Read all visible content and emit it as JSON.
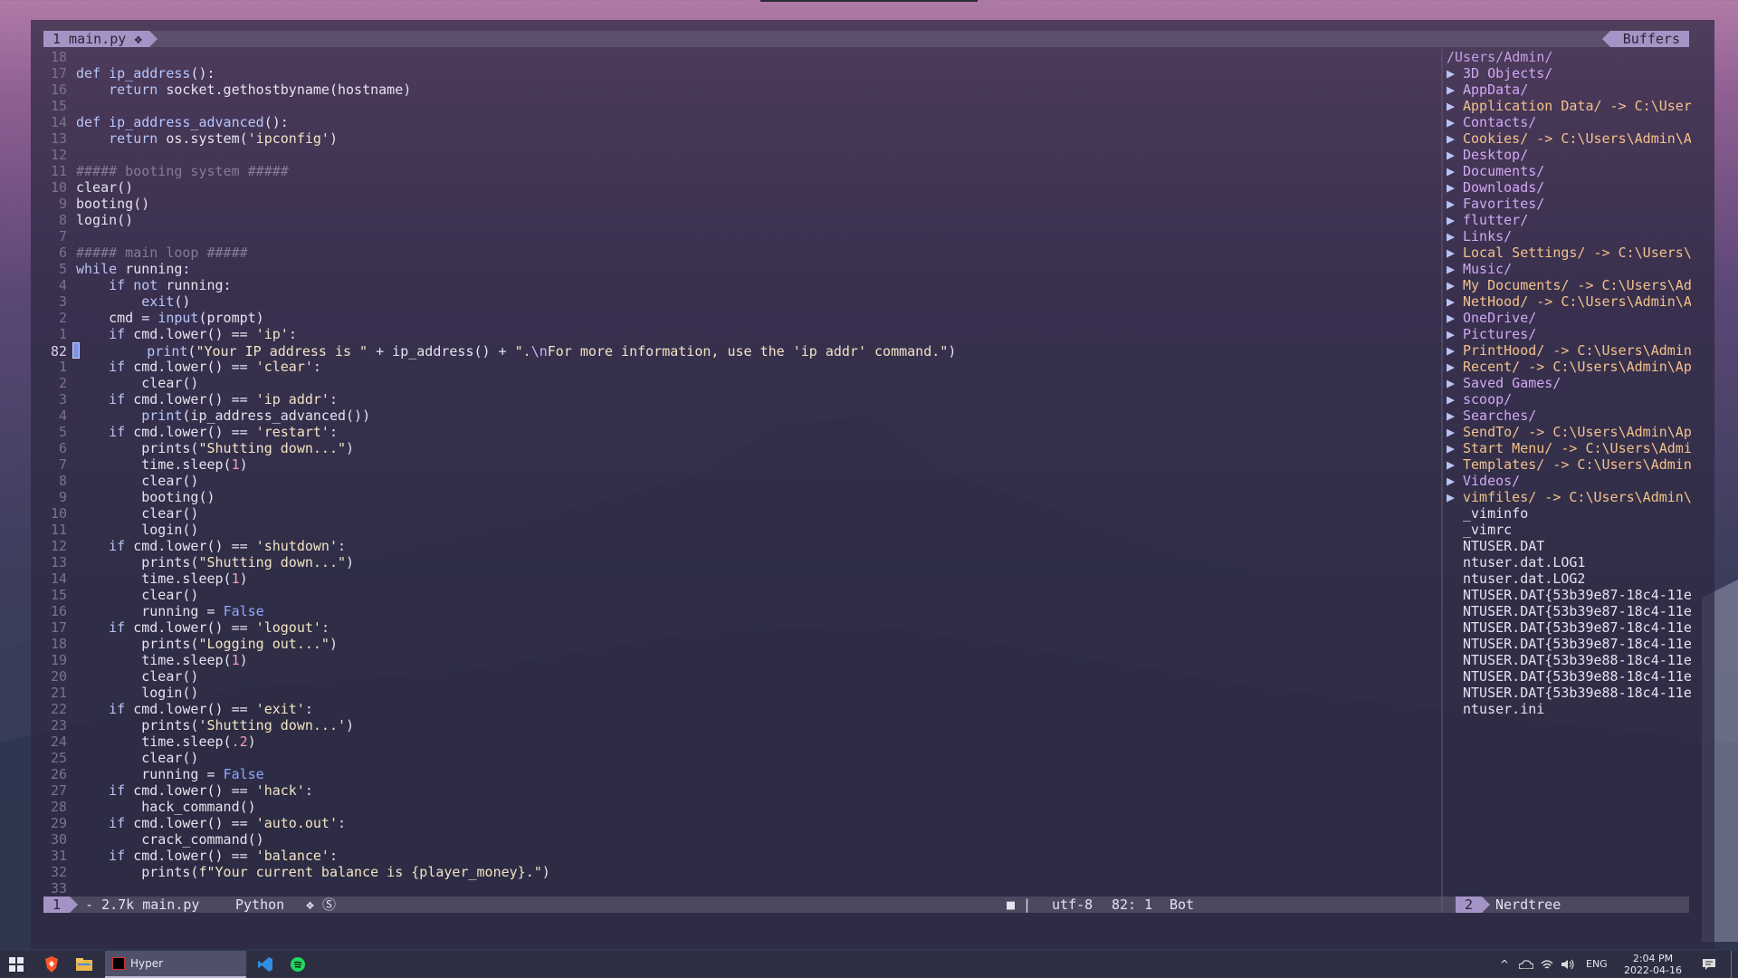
{
  "editor": {
    "tab_label": "1 main.py ❖",
    "buffers_label": "Buffers",
    "lines": [
      {
        "num": "18",
        "segs": []
      },
      {
        "num": "17",
        "segs": [
          [
            "kw",
            "def "
          ],
          [
            "fn",
            "ip_address"
          ],
          [
            "",
            "():"
          ]
        ]
      },
      {
        "num": "16",
        "segs": [
          [
            "",
            "    "
          ],
          [
            "kw",
            "return "
          ],
          [
            "",
            "socket.gethostbyname(hostname)"
          ]
        ]
      },
      {
        "num": "15",
        "segs": []
      },
      {
        "num": "14",
        "segs": [
          [
            "kw",
            "def "
          ],
          [
            "fn",
            "ip_address_advanced"
          ],
          [
            "",
            "():"
          ]
        ]
      },
      {
        "num": "13",
        "segs": [
          [
            "",
            "    "
          ],
          [
            "kw",
            "return "
          ],
          [
            "",
            "os.system("
          ],
          [
            "str",
            "'ipconfig'"
          ],
          [
            "",
            ")"
          ]
        ]
      },
      {
        "num": "12",
        "segs": []
      },
      {
        "num": "11",
        "segs": [
          [
            "cmt",
            "##### booting system #####"
          ]
        ]
      },
      {
        "num": "10",
        "segs": [
          [
            "",
            "clear()"
          ]
        ]
      },
      {
        "num": "9",
        "segs": [
          [
            "",
            "booting()"
          ]
        ]
      },
      {
        "num": "8",
        "segs": [
          [
            "",
            "login()"
          ]
        ]
      },
      {
        "num": "7",
        "segs": []
      },
      {
        "num": "6",
        "segs": [
          [
            "cmt",
            "##### main loop #####"
          ]
        ]
      },
      {
        "num": "5",
        "segs": [
          [
            "kw",
            "while "
          ],
          [
            "",
            "running:"
          ]
        ]
      },
      {
        "num": "4",
        "segs": [
          [
            "",
            "    "
          ],
          [
            "kw",
            "if not "
          ],
          [
            "",
            "running:"
          ]
        ]
      },
      {
        "num": "3",
        "segs": [
          [
            "",
            "        "
          ],
          [
            "fn",
            "exit"
          ],
          [
            "",
            "()"
          ]
        ]
      },
      {
        "num": "2",
        "segs": [
          [
            "",
            "    cmd = "
          ],
          [
            "fn",
            "input"
          ],
          [
            "",
            "(prompt)"
          ]
        ]
      },
      {
        "num": "1",
        "segs": [
          [
            "",
            "    "
          ],
          [
            "kw",
            "if "
          ],
          [
            "",
            "cmd.lower() == "
          ],
          [
            "str",
            "'ip'"
          ],
          [
            "",
            ":"
          ]
        ]
      },
      {
        "num": "82",
        "cursor": true,
        "segs": [
          [
            "",
            "        "
          ],
          [
            "fn",
            "print"
          ],
          [
            "",
            "("
          ],
          [
            "str",
            "\"Your IP address is \""
          ],
          [
            "",
            " + ip_address() + "
          ],
          [
            "str",
            "\"."
          ],
          [
            "esc",
            "\\n"
          ],
          [
            "str",
            "For more information, use the 'ip addr' command.\""
          ],
          [
            "",
            ")"
          ]
        ]
      },
      {
        "num": "1",
        "segs": [
          [
            "",
            "    "
          ],
          [
            "kw",
            "if "
          ],
          [
            "",
            "cmd.lower() == "
          ],
          [
            "str",
            "'clear'"
          ],
          [
            "",
            ":"
          ]
        ]
      },
      {
        "num": "2",
        "segs": [
          [
            "",
            "        clear()"
          ]
        ]
      },
      {
        "num": "3",
        "segs": [
          [
            "",
            "    "
          ],
          [
            "kw",
            "if "
          ],
          [
            "",
            "cmd.lower() == "
          ],
          [
            "str",
            "'ip addr'"
          ],
          [
            "",
            ":"
          ]
        ]
      },
      {
        "num": "4",
        "segs": [
          [
            "",
            "        "
          ],
          [
            "fn",
            "print"
          ],
          [
            "",
            "(ip_address_advanced())"
          ]
        ]
      },
      {
        "num": "5",
        "segs": [
          [
            "",
            "    "
          ],
          [
            "kw",
            "if "
          ],
          [
            "",
            "cmd.lower() == "
          ],
          [
            "str",
            "'restart'"
          ],
          [
            "",
            ":"
          ]
        ]
      },
      {
        "num": "6",
        "segs": [
          [
            "",
            "        prints("
          ],
          [
            "str",
            "\"Shutting down...\""
          ],
          [
            "",
            ")"
          ]
        ]
      },
      {
        "num": "7",
        "segs": [
          [
            "",
            "        time.sleep("
          ],
          [
            "num",
            "1"
          ],
          [
            "",
            ")"
          ]
        ]
      },
      {
        "num": "8",
        "segs": [
          [
            "",
            "        clear()"
          ]
        ]
      },
      {
        "num": "9",
        "segs": [
          [
            "",
            "        booting()"
          ]
        ]
      },
      {
        "num": "10",
        "segs": [
          [
            "",
            "        clear()"
          ]
        ]
      },
      {
        "num": "11",
        "segs": [
          [
            "",
            "        login()"
          ]
        ]
      },
      {
        "num": "12",
        "segs": [
          [
            "",
            "    "
          ],
          [
            "kw",
            "if "
          ],
          [
            "",
            "cmd.lower() == "
          ],
          [
            "str",
            "'shutdown'"
          ],
          [
            "",
            ":"
          ]
        ]
      },
      {
        "num": "13",
        "segs": [
          [
            "",
            "        prints("
          ],
          [
            "str",
            "\"Shutting down...\""
          ],
          [
            "",
            ")"
          ]
        ]
      },
      {
        "num": "14",
        "segs": [
          [
            "",
            "        time.sleep("
          ],
          [
            "num",
            "1"
          ],
          [
            "",
            ")"
          ]
        ]
      },
      {
        "num": "15",
        "segs": [
          [
            "",
            "        clear()"
          ]
        ]
      },
      {
        "num": "16",
        "segs": [
          [
            "",
            "        running = "
          ],
          [
            "bool",
            "False"
          ]
        ]
      },
      {
        "num": "17",
        "segs": [
          [
            "",
            "    "
          ],
          [
            "kw",
            "if "
          ],
          [
            "",
            "cmd.lower() == "
          ],
          [
            "str",
            "'logout'"
          ],
          [
            "",
            ":"
          ]
        ]
      },
      {
        "num": "18",
        "segs": [
          [
            "",
            "        prints("
          ],
          [
            "str",
            "\"Logging out...\""
          ],
          [
            "",
            ")"
          ]
        ]
      },
      {
        "num": "19",
        "segs": [
          [
            "",
            "        time.sleep("
          ],
          [
            "num",
            "1"
          ],
          [
            "",
            ")"
          ]
        ]
      },
      {
        "num": "20",
        "segs": [
          [
            "",
            "        clear()"
          ]
        ]
      },
      {
        "num": "21",
        "segs": [
          [
            "",
            "        login()"
          ]
        ]
      },
      {
        "num": "22",
        "segs": [
          [
            "",
            "    "
          ],
          [
            "kw",
            "if "
          ],
          [
            "",
            "cmd.lower() == "
          ],
          [
            "str",
            "'exit'"
          ],
          [
            "",
            ":"
          ]
        ]
      },
      {
        "num": "23",
        "segs": [
          [
            "",
            "        prints("
          ],
          [
            "str",
            "'Shutting down...'"
          ],
          [
            "",
            ")"
          ]
        ]
      },
      {
        "num": "24",
        "segs": [
          [
            "",
            "        time.sleep("
          ],
          [
            "num",
            ".2"
          ],
          [
            "",
            ")"
          ]
        ]
      },
      {
        "num": "25",
        "segs": [
          [
            "",
            "        clear()"
          ]
        ]
      },
      {
        "num": "26",
        "segs": [
          [
            "",
            "        running = "
          ],
          [
            "bool",
            "False"
          ]
        ]
      },
      {
        "num": "27",
        "segs": [
          [
            "",
            "    "
          ],
          [
            "kw",
            "if "
          ],
          [
            "",
            "cmd.lower() == "
          ],
          [
            "str",
            "'hack'"
          ],
          [
            "",
            ":"
          ]
        ]
      },
      {
        "num": "28",
        "segs": [
          [
            "",
            "        hack_command()"
          ]
        ]
      },
      {
        "num": "29",
        "segs": [
          [
            "",
            "    "
          ],
          [
            "kw",
            "if "
          ],
          [
            "",
            "cmd.lower() == "
          ],
          [
            "str",
            "'auto.out'"
          ],
          [
            "",
            ":"
          ]
        ]
      },
      {
        "num": "30",
        "segs": [
          [
            "",
            "        crack_command()"
          ]
        ]
      },
      {
        "num": "31",
        "segs": [
          [
            "",
            "    "
          ],
          [
            "kw",
            "if "
          ],
          [
            "",
            "cmd.lower() == "
          ],
          [
            "str",
            "'balance'"
          ],
          [
            "",
            ":"
          ]
        ]
      },
      {
        "num": "32",
        "segs": [
          [
            "",
            "        prints("
          ],
          [
            "str",
            "f\"Your current balance is {player_money}.\""
          ],
          [
            "",
            ")"
          ]
        ]
      },
      {
        "num": "33",
        "segs": []
      }
    ]
  },
  "nerdtree": {
    "root": "/Users/Admin/",
    "entries": [
      {
        "type": "dir",
        "name": "3D Objects/"
      },
      {
        "type": "dir",
        "name": "AppData/"
      },
      {
        "type": "link",
        "name": "Application Data/ -> C:\\User"
      },
      {
        "type": "dir",
        "name": "Contacts/"
      },
      {
        "type": "link",
        "name": "Cookies/ -> C:\\Users\\Admin\\A"
      },
      {
        "type": "dir",
        "name": "Desktop/"
      },
      {
        "type": "dir",
        "name": "Documents/"
      },
      {
        "type": "dir",
        "name": "Downloads/"
      },
      {
        "type": "dir",
        "name": "Favorites/"
      },
      {
        "type": "dir",
        "name": "flutter/"
      },
      {
        "type": "dir",
        "name": "Links/"
      },
      {
        "type": "link",
        "name": "Local Settings/ -> C:\\Users\\"
      },
      {
        "type": "dir",
        "name": "Music/"
      },
      {
        "type": "link",
        "name": "My Documents/ -> C:\\Users\\Ad"
      },
      {
        "type": "link",
        "name": "NetHood/ -> C:\\Users\\Admin\\A"
      },
      {
        "type": "dir",
        "name": "OneDrive/"
      },
      {
        "type": "dir",
        "name": "Pictures/"
      },
      {
        "type": "link",
        "name": "PrintHood/ -> C:\\Users\\Admin"
      },
      {
        "type": "link",
        "name": "Recent/ -> C:\\Users\\Admin\\Ap"
      },
      {
        "type": "dir",
        "name": "Saved Games/"
      },
      {
        "type": "dir",
        "name": "scoop/"
      },
      {
        "type": "dir",
        "name": "Searches/"
      },
      {
        "type": "link",
        "name": "SendTo/ -> C:\\Users\\Admin\\Ap"
      },
      {
        "type": "link",
        "name": "Start Menu/ -> C:\\Users\\Admi"
      },
      {
        "type": "link",
        "name": "Templates/ -> C:\\Users\\Admin"
      },
      {
        "type": "dir",
        "name": "Videos/"
      },
      {
        "type": "link",
        "name": "vimfiles/ -> C:\\Users\\Admin\\"
      },
      {
        "type": "file",
        "name": "_viminfo"
      },
      {
        "type": "file",
        "name": "_vimrc"
      },
      {
        "type": "file",
        "name": "NTUSER.DAT"
      },
      {
        "type": "file",
        "name": "ntuser.dat.LOG1"
      },
      {
        "type": "file",
        "name": "ntuser.dat.LOG2"
      },
      {
        "type": "file",
        "name": "NTUSER.DAT{53b39e87-18c4-11e"
      },
      {
        "type": "file",
        "name": "NTUSER.DAT{53b39e87-18c4-11e"
      },
      {
        "type": "file",
        "name": "NTUSER.DAT{53b39e87-18c4-11e"
      },
      {
        "type": "file",
        "name": "NTUSER.DAT{53b39e87-18c4-11e"
      },
      {
        "type": "file",
        "name": "NTUSER.DAT{53b39e88-18c4-11e"
      },
      {
        "type": "file",
        "name": "NTUSER.DAT{53b39e88-18c4-11e"
      },
      {
        "type": "file",
        "name": "NTUSER.DAT{53b39e88-18c4-11e"
      },
      {
        "type": "file",
        "name": "ntuser.ini"
      }
    ]
  },
  "statusline": {
    "mode": "1",
    "file": "- 2.7k main.py",
    "filetype": "Python",
    "icons": "❖ Ⓢ",
    "right_icon": "■ |",
    "encoding": "utf-8",
    "position": "82:  1",
    "scroll": "Bot",
    "tree_num": "2",
    "tree_label": "Nerdtree"
  },
  "taskbar": {
    "app_label": "Hyper",
    "lang": "ENG",
    "time": "2:04 PM",
    "date": "2022-04-16"
  },
  "colors": {
    "accent": "#a494c6",
    "keyword": "#b8c4f4",
    "string": "#f2e3c4",
    "number": "#f0a0b0",
    "comment": "#847a98",
    "dir": "#d0a8f4",
    "link": "#f3c18a"
  }
}
